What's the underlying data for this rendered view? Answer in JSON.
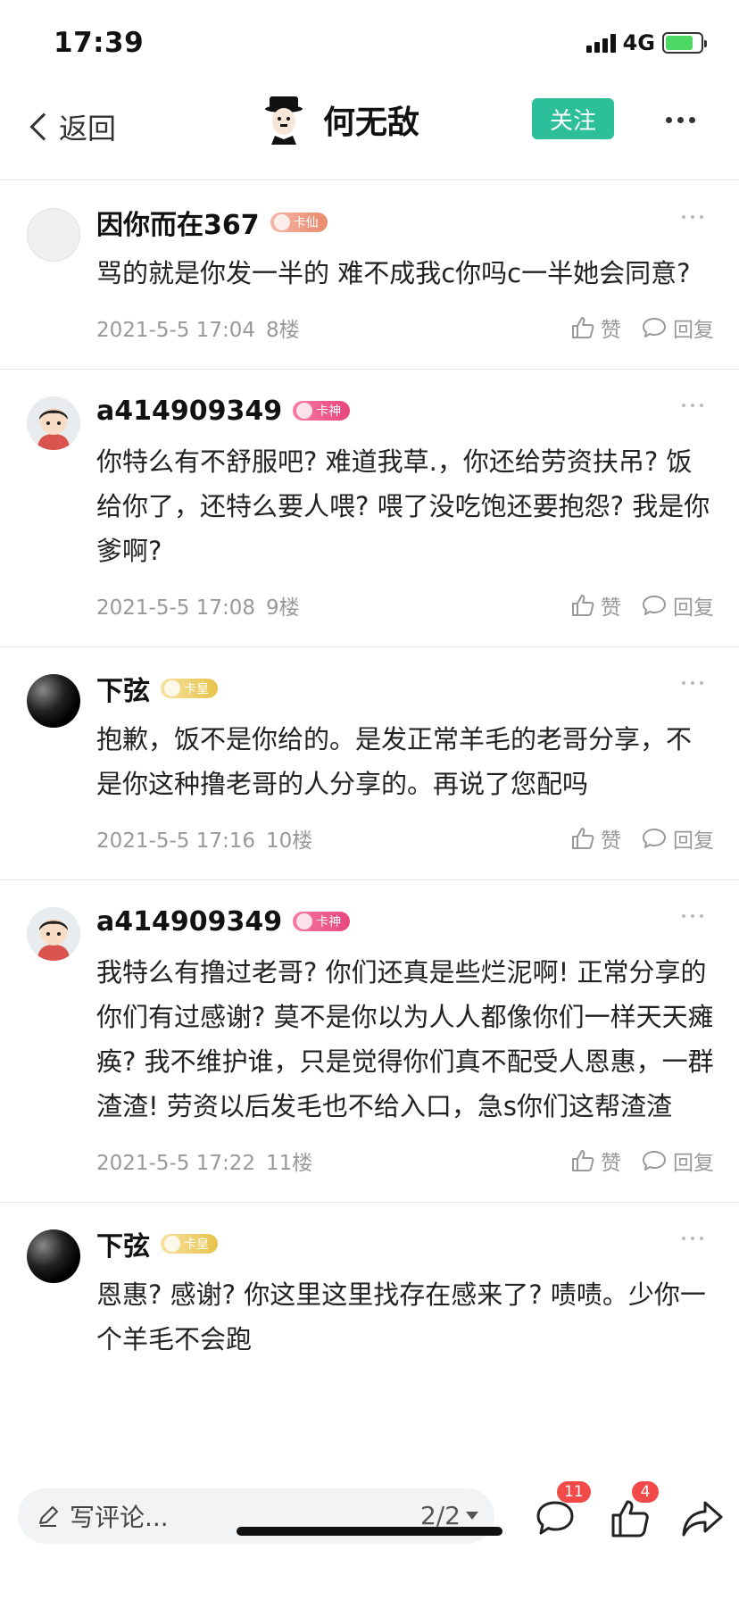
{
  "status_bar": {
    "time": "17:39",
    "network": "4G",
    "battery_level": 0.8
  },
  "nav": {
    "back_label": "返回",
    "title": "何无敌",
    "follow_label": "关注"
  },
  "comments": [
    {
      "username": "因你而在367",
      "badge": "卡仙",
      "avatar": "blank-avatar",
      "text": "骂的就是你发一半的  难不成我c你吗c一半她会同意?",
      "date": "2021-5-5 17:04",
      "floor": "8楼",
      "like_label": "赞",
      "reply_label": "回复"
    },
    {
      "username": "a414909349",
      "badge": "卡神",
      "avatar": "boy-avatar",
      "text": "你特么有不舒服吧? 难道我草.，你还给劳资扶吊? 饭给你了，还特么要人喂? 喂了没吃饱还要抱怨? 我是你爹啊?",
      "date": "2021-5-5 17:08",
      "floor": "9楼",
      "like_label": "赞",
      "reply_label": "回复"
    },
    {
      "username": "下弦",
      "badge": "卡皇",
      "avatar": "dark-avatar",
      "text": "抱歉，饭不是你给的。是发正常羊毛的老哥分享，不是你这种撸老哥的人分享的。再说了您配吗",
      "date": "2021-5-5 17:16",
      "floor": "10楼",
      "like_label": "赞",
      "reply_label": "回复"
    },
    {
      "username": "a414909349",
      "badge": "卡神",
      "avatar": "boy-avatar",
      "text": "我特么有撸过老哥? 你们还真是些烂泥啊! 正常分享的你们有过感谢? 莫不是你以为人人都像你们一样天天瘫痪? 我不维护谁，只是觉得你们真不配受人恩惠，一群渣渣! 劳资以后发毛也不给入口，急s你们这帮渣渣",
      "date": "2021-5-5 17:22",
      "floor": "11楼",
      "like_label": "赞",
      "reply_label": "回复"
    },
    {
      "username": "下弦",
      "badge": "卡皇",
      "avatar": "dark-avatar",
      "text": "恩惠? 感谢? 你这里这里找存在感来了? 啧啧。少你一个羊毛不会跑",
      "date": "",
      "floor": "",
      "like_label": "",
      "reply_label": ""
    }
  ],
  "toolbar": {
    "write_placeholder": "写评论...",
    "page": "2/2",
    "comment_count": "11",
    "like_count": "4"
  },
  "colors": {
    "accent": "#2dbe9a",
    "badge_red": "#f24a48"
  }
}
